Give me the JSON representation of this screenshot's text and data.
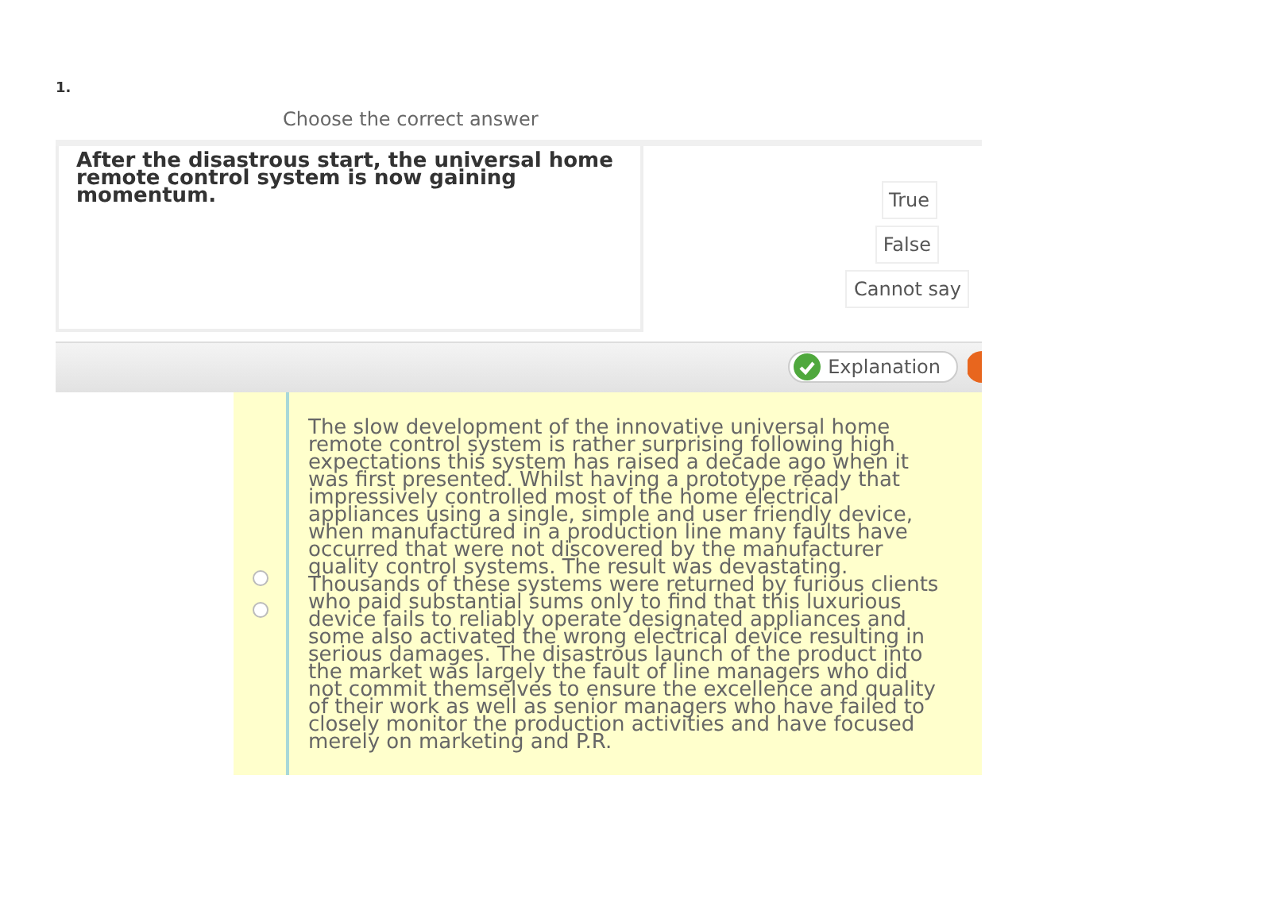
{
  "question_number": "1.",
  "instruction": "Choose the correct answer",
  "statement": "After the disastrous start, the universal home remote control system is now gaining momentum.",
  "options": [
    "True",
    "False",
    "Cannot say"
  ],
  "toolbar": {
    "explanation_button": "Explanation"
  },
  "explanation": {
    "radios": [
      {
        "selected": false
      },
      {
        "selected": false
      }
    ],
    "text": "The slow development of the innovative universal home remote control system is rather surprising following high expectations this system has raised a decade ago when it was first presented. Whilst having a prototype ready that impressively controlled most of the home electrical appliances using a single, simple and user friendly device, when manufactured in a production line many faults have occurred that were not discovered by the manufacturer quality control systems. The result was devastating. Thousands of these systems were returned by furious clients who paid substantial sums only to find that this luxurious device fails to reliably operate designated appliances and some also activated the wrong electrical device resulting in serious damages. The disastrous launch of the product into the market was largely the fault of line managers who did not commit themselves to ensure the excellence and quality of their work as well as senior managers who have failed to closely monitor the production activities and have focused merely on marketing and P.R."
  }
}
